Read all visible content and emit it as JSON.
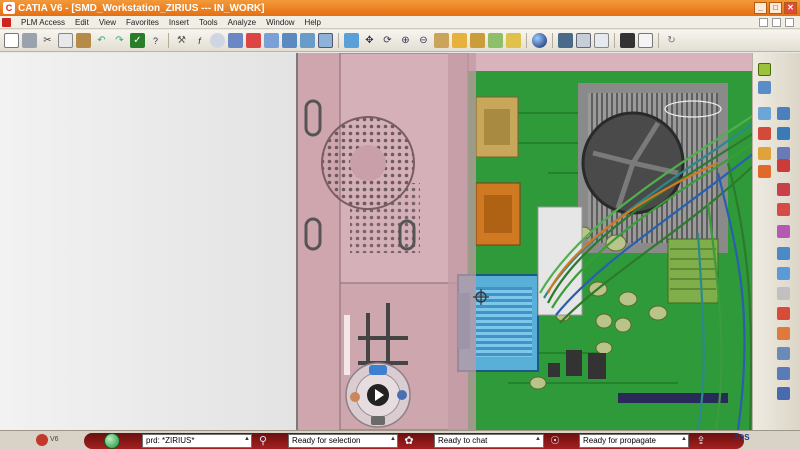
{
  "window": {
    "title": "CATIA V6 - [SMD_Workstation_ZIRIUS --- IN_WORK]",
    "logo_text": "C",
    "minimize": "_",
    "maximize": "□",
    "close": "✕"
  },
  "menu": {
    "items": [
      "PLM Access",
      "Edit",
      "View",
      "Favorites",
      "Insert",
      "Tools",
      "Analyze",
      "Window",
      "Help"
    ]
  },
  "toolbar": {
    "icons": [
      "new-icon",
      "print-icon",
      "cut-icon",
      "copy-icon",
      "paste-icon",
      "undo-icon",
      "redo-icon",
      "whats-this-icon",
      "formula-icon",
      "fx-icon",
      "comment-icon",
      "catalog-icon",
      "publish-icon",
      "share-icon",
      "table-icon",
      "fit-all-icon",
      "pan-icon",
      "rotate-icon",
      "zoom-in-icon",
      "zoom-out-icon",
      "normal-view-icon",
      "iso-view-icon",
      "shading-icon",
      "hide-show-icon",
      "swap-icon",
      "sphere-icon",
      "capture-icon",
      "video-icon",
      "refresh-icon"
    ]
  },
  "right_toolbar": {
    "icons": [
      "compass-icon",
      "edit-icon",
      "explode-icon",
      "connect-icon",
      "route-icon",
      "constraint-icon",
      "measure-icon",
      "section-icon",
      "bill-icon",
      "catalog-icon",
      "plane-icon"
    ]
  },
  "viewport": {
    "description_icons": [
      "cursor-icon"
    ]
  },
  "statusbar": {
    "version": "V6",
    "search_query": "prd: *ZIRIUS*",
    "selection_status": "Ready for selection",
    "chat_status": "Ready to chat",
    "propagate_status": "Ready for propagate",
    "ds_logo": "3DS"
  },
  "colors": {
    "title_orange": "#e8761a",
    "board_green": "#2f9a3a",
    "case_pink": "#d9b7bf",
    "connector_blue": "#58b0d8",
    "connector_orange": "#cf7a22",
    "connector_tan": "#c8a65a"
  }
}
